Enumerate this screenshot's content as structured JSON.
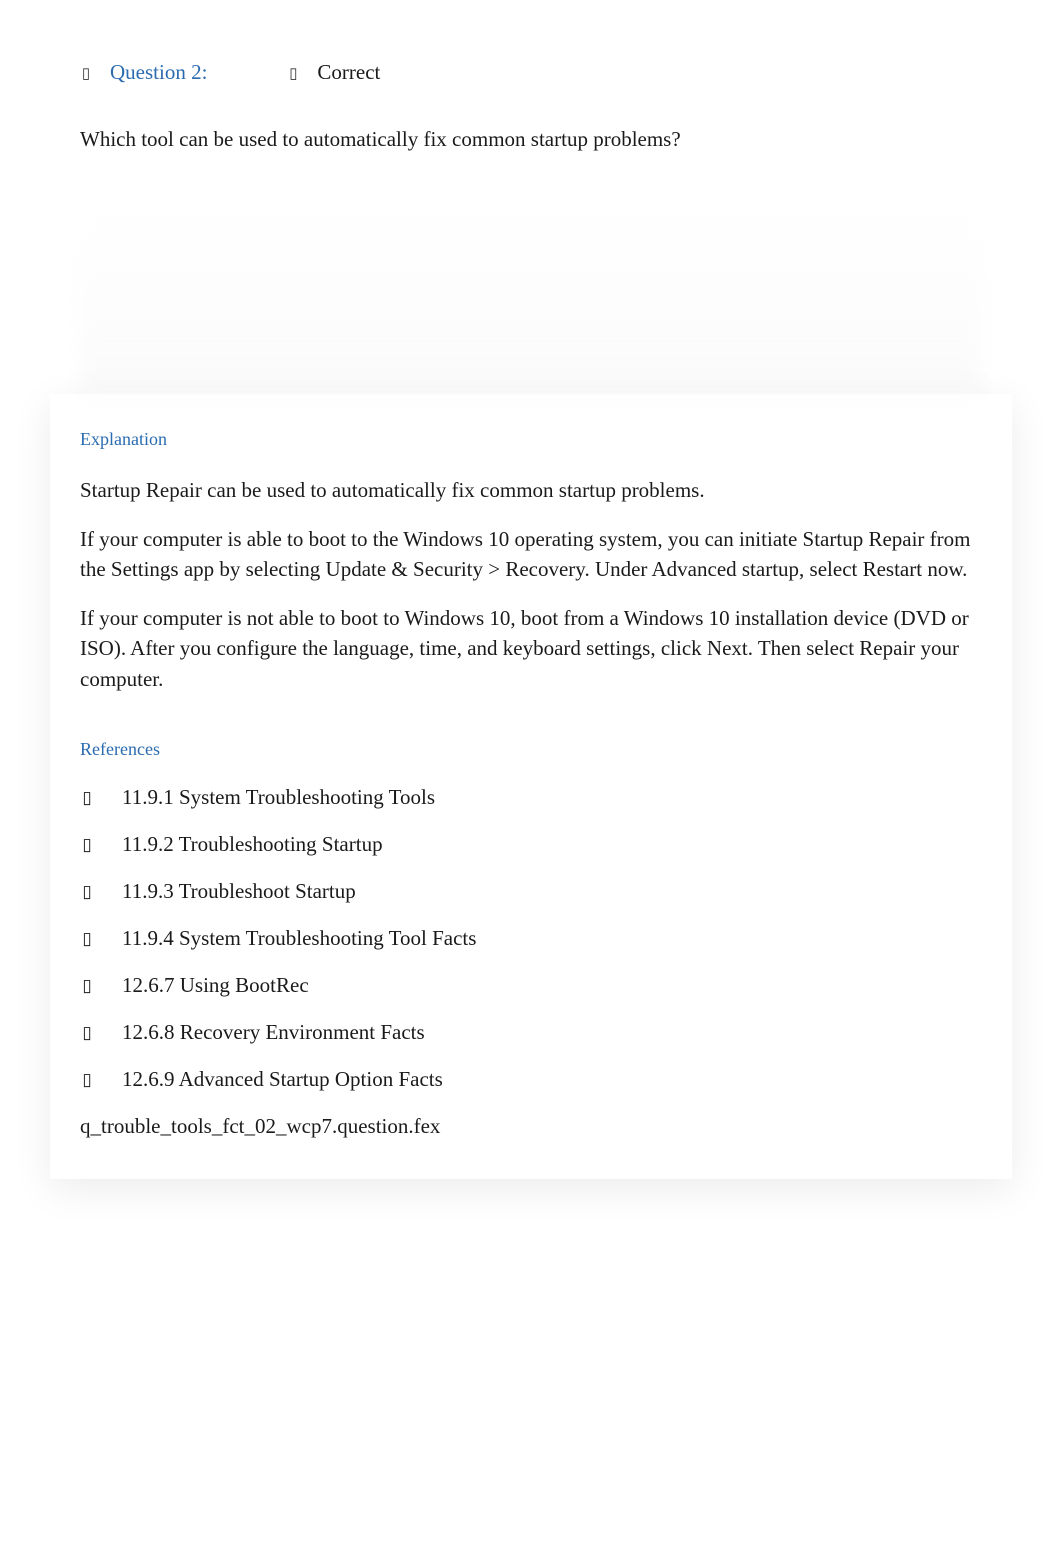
{
  "header": {
    "question_label": "Question 2:",
    "status": "Correct"
  },
  "question": {
    "text": "Which tool can be used to automatically fix common startup problems?"
  },
  "explanation": {
    "heading": "Explanation",
    "paragraphs": [
      "Startup Repair can be used to automatically fix common startup problems.",
      "If your computer is able to boot to the Windows 10 operating system, you can initiate Startup Repair from the Settings app by selecting Update & Security > Recovery. Under Advanced startup, select Restart now.",
      "If your computer is not able to boot to Windows 10, boot from a Windows 10 installation device (DVD or ISO). After you configure the language, time, and keyboard settings, click Next. Then select Repair your computer."
    ]
  },
  "references": {
    "heading": "References",
    "items": [
      "11.9.1 System Troubleshooting Tools",
      "11.9.2 Troubleshooting Startup",
      "11.9.3 Troubleshoot Startup",
      "11.9.4 System Troubleshooting Tool Facts",
      "12.6.7 Using BootRec",
      "12.6.8 Recovery Environment Facts",
      "12.6.9 Advanced Startup Option Facts"
    ]
  },
  "question_file": "q_trouble_tools_fct_02_wcp7.question.fex",
  "icons": {
    "placeholder_glyph": "▯"
  }
}
